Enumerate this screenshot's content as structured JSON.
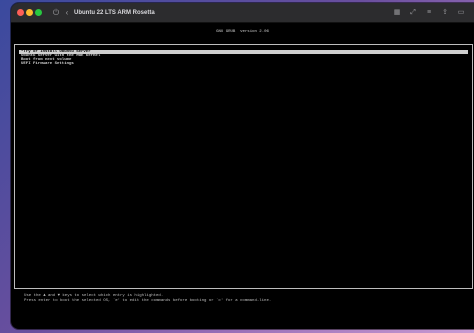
{
  "window": {
    "title": "Ubuntu 22 LTS ARM Rosetta",
    "toolbar_icons": [
      "power-icon",
      "back-icon"
    ],
    "right_icons": [
      "grid-icon",
      "resize-icon",
      "sliders-icon",
      "share-icon",
      "window-icon"
    ]
  },
  "grub": {
    "title": "GNU GRUB  version 2.06",
    "menu": [
      {
        "label": "*Try or Install Ubuntu Server",
        "selected": true
      },
      {
        "label": "Ubuntu Server with the HWE kernel",
        "selected": false
      },
      {
        "label": "Boot from next volume",
        "selected": false
      },
      {
        "label": "UEFI Firmware Settings",
        "selected": false
      }
    ],
    "help_line1": "Use the ▲ and ▼ keys to select which entry is highlighted.",
    "help_line2": "Press enter to boot the selected OS, `e' to edit the commands before booting or `c' for a command-line."
  }
}
